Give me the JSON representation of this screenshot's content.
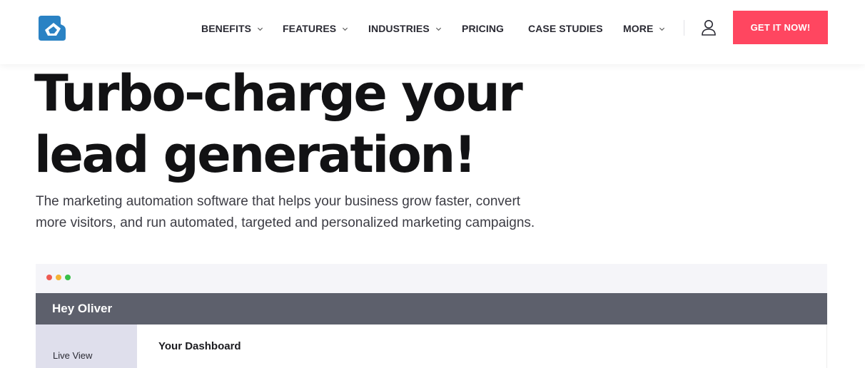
{
  "header": {
    "logo": "logo-icon",
    "nav": [
      {
        "label": "BENEFITS",
        "dropdown": true
      },
      {
        "label": "FEATURES",
        "dropdown": true
      },
      {
        "label": "INDUSTRIES",
        "dropdown": true
      },
      {
        "label": "PRICING",
        "dropdown": false
      },
      {
        "label": "CASE STUDIES",
        "dropdown": false
      },
      {
        "label": "MORE",
        "dropdown": true
      }
    ],
    "user_icon": "user-icon",
    "cta_label": "GET IT NOW!"
  },
  "hero": {
    "title_line1": "Turbo-charge your",
    "title_line2": "lead generation!",
    "subtitle_line1": "The marketing automation software that helps your business grow faster, convert",
    "subtitle_line2": "more visitors, and run automated, targeted and personalized marketing campaigns."
  },
  "mockup": {
    "window_dots": [
      "#ee5a52",
      "#f5b335",
      "#38c049"
    ],
    "greeting": "Hey Oliver",
    "sidebar_item": "Live View",
    "main_title": "Your Dashboard"
  },
  "colors": {
    "accent": "#ff4660",
    "mock_header": "#5d606c",
    "mock_sidebar": "#dfdfec"
  }
}
